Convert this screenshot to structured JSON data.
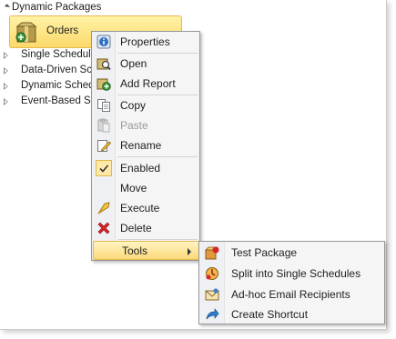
{
  "tree": {
    "root_label": "Dynamic Packages",
    "selected_label": "Orders",
    "items": [
      {
        "label": "Single Schedule"
      },
      {
        "label": "Data-Driven Sch"
      },
      {
        "label": "Dynamic Sched"
      },
      {
        "label": "Event-Based Sc"
      }
    ]
  },
  "context_menu": {
    "items": [
      {
        "label": "Properties",
        "icon": "properties-icon"
      },
      {
        "label": "Open",
        "icon": "open-icon"
      },
      {
        "label": "Add Report",
        "icon": "add-report-icon"
      },
      {
        "label": "Copy",
        "icon": "copy-icon"
      },
      {
        "label": "Paste",
        "icon": "paste-icon",
        "disabled": true
      },
      {
        "label": "Rename",
        "icon": "rename-icon"
      },
      {
        "label": "Enabled",
        "icon": "check-icon",
        "checked": true
      },
      {
        "label": "Move",
        "icon": ""
      },
      {
        "label": "Execute",
        "icon": "execute-icon"
      },
      {
        "label": "Delete",
        "icon": "delete-icon"
      },
      {
        "label": "Tools",
        "icon": "",
        "has_submenu": true
      }
    ]
  },
  "tools_submenu": {
    "items": [
      {
        "label": "Test Package",
        "icon": "test-package-icon"
      },
      {
        "label": "Split into Single Schedules",
        "icon": "split-icon"
      },
      {
        "label": "Ad-hoc Email Recipients",
        "icon": "email-recipients-icon"
      },
      {
        "label": "Create Shortcut",
        "icon": "shortcut-icon"
      }
    ]
  },
  "colors": {
    "highlight_top": "#fff4c2",
    "highlight_bottom": "#fbd97a",
    "highlight_border": "#e6b94f",
    "menu_bg": "#f5f5f5",
    "delete_red": "#d8232a"
  }
}
